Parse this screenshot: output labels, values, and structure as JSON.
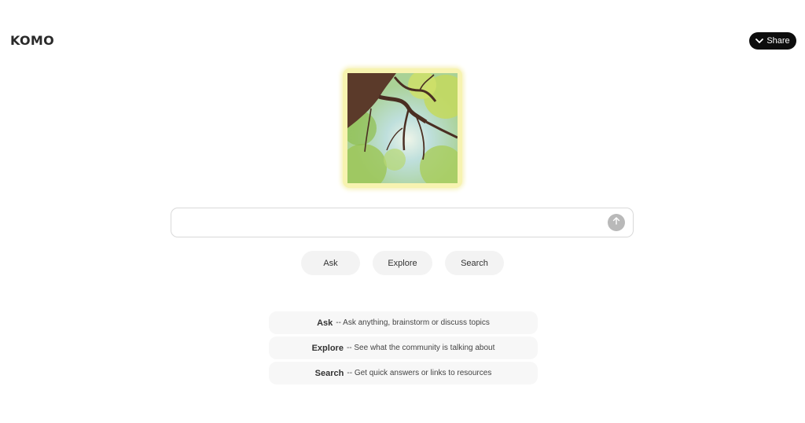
{
  "header": {
    "logo": "KOMO",
    "share_label": "Share"
  },
  "hero": {
    "image_alt": "tree canopy artwork",
    "frame_color": "#f7f3b0"
  },
  "search": {
    "value": "",
    "placeholder": ""
  },
  "modes": [
    {
      "label": "Ask"
    },
    {
      "label": "Explore"
    },
    {
      "label": "Search"
    }
  ],
  "descriptions": [
    {
      "term": "Ask",
      "text": "-- Ask anything, brainstorm or discuss topics"
    },
    {
      "term": "Explore",
      "text": "-- See what the community is talking about"
    },
    {
      "term": "Search",
      "text": "-- Get quick answers or links to resources"
    }
  ],
  "icons": {
    "share": "chevron-down-icon",
    "send": "arrow-up-icon"
  }
}
